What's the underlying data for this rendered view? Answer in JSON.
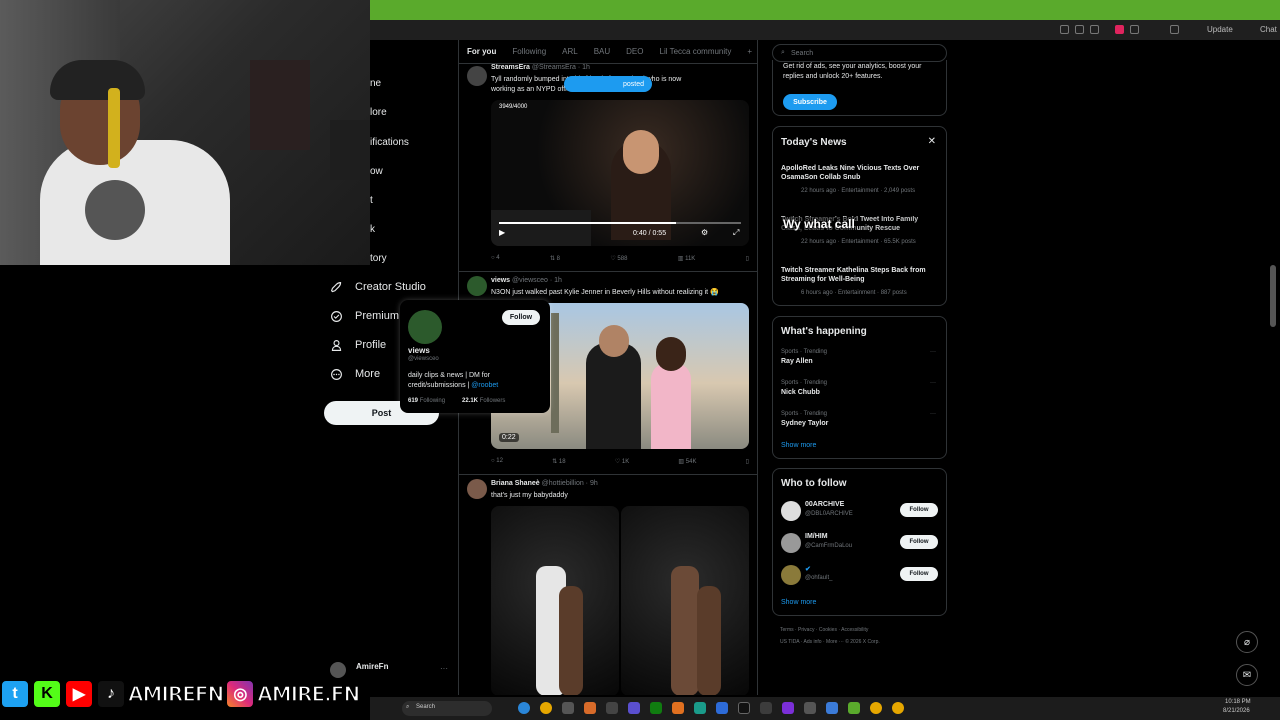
{
  "browser": {
    "update_label": "Update",
    "chat_label": "Chat"
  },
  "nav": {
    "partial_items": [
      "ne",
      "lore",
      "ifications",
      "ow",
      "t",
      "k",
      "tory"
    ],
    "items": [
      {
        "label": "Creator Studio",
        "icon": "rocket-icon"
      },
      {
        "label": "Premium",
        "icon": "premium-icon"
      },
      {
        "label": "Profile",
        "icon": "profile-icon"
      },
      {
        "label": "More",
        "icon": "more-circle-icon"
      }
    ],
    "post_label": "Post",
    "account_name": "AmireFn"
  },
  "feed": {
    "tabs": [
      "For you",
      "Following",
      "ARL",
      "BAU",
      "DEO",
      "Lil Tecca community"
    ],
    "posted_pill": "posted",
    "tweets": [
      {
        "name": "StreamsEra",
        "handle": "@StreamsEra · 1h",
        "text_lines": [
          "Tyll randomly bumped into his friends from school who is now",
          "working as an NYPD officer"
        ],
        "video_time": "0:40 / 0:55",
        "overlay_count": "3949/4000",
        "stats": {
          "replies": "4",
          "reposts": "8",
          "likes": "588",
          "views": "11K"
        }
      },
      {
        "name": "views",
        "handle": "@viewsceo · 1h",
        "text": "N3ON just walked past Kylie Jenner in Beverly Hills without realizing it 😭",
        "duration": "0:22",
        "stats": {
          "replies": "12",
          "reposts": "18",
          "likes": "1K",
          "views": "54K"
        }
      },
      {
        "name": "Briana Shaneè",
        "handle": "@hottiebillion · 9h",
        "text": "that's just my babydaddy"
      }
    ]
  },
  "hovercard": {
    "name": "views",
    "handle": "@viewsceo",
    "follow_label": "Follow",
    "bio_line1": "daily clips & news | DM for",
    "bio_line2": "credit/submissions |",
    "bio_link": "@roobet",
    "following_count": "619",
    "following_label": "Following",
    "followers_count": "22.1K",
    "followers_label": "Followers"
  },
  "right": {
    "search_placeholder": "Search",
    "premium_text_1": "Get rid of ads, see your analytics, boost your",
    "premium_text_2": "replies and unlock 20+ features.",
    "subscribe_label": "Subscribe",
    "news_title": "Today's News",
    "news": [
      {
        "headline_1": "ApolloRed Leaks Nine Vicious Texts Over",
        "headline_2": "OsamaSon Collab Snub",
        "meta": "22 hours ago · Entertainment · 2,049 posts"
      },
      {
        "headline_1": "Twitch Streamer's Bold Tweet Into Family",
        "headline_2": "Clash, Leads to Community Rescue",
        "meta": "22 hours ago · Entertainment · 65.5K posts"
      },
      {
        "headline_1": "Twitch Streamer Kathelina Steps Back from",
        "headline_2": "Streaming for Well-Being",
        "meta": "6 hours ago · Entertainment · 887 posts"
      }
    ],
    "caption_overlay": "what call",
    "happening_title": "What's happening",
    "trends": [
      {
        "category": "Sports · Trending",
        "name": "Ray Allen"
      },
      {
        "category": "Sports · Trending",
        "name": "Nick Chubb"
      },
      {
        "category": "Sports · Trending",
        "name": "Sydney Taylor"
      }
    ],
    "show_more": "Show more",
    "who_title": "Who to follow",
    "follow_suggestions": [
      {
        "name": "00ARCHIVE",
        "handle": "@DBL0ARCHIVE"
      },
      {
        "name": "IM/HIM",
        "handle": "@CamFrmDaLou"
      },
      {
        "name": "",
        "handle": "@ohfault_"
      }
    ],
    "follow_label": "Follow",
    "footer_1": "Terms  ·  Privacy  ·  Cookies  ·  Accessibility",
    "footer_2": "US TIDA  ·  Ads info  ·  More ···  © 2026 X Corp."
  },
  "taskbar": {
    "search_label": "Search",
    "time": "10:18 PM",
    "date": "8/21/2026"
  },
  "overlay": {
    "handle_1": "AMIREFN",
    "handle_2": "AMIRE.FN"
  },
  "colors": {
    "accent": "#1d9bf0",
    "green_bar": "#5aaa2c",
    "background": "#000000"
  }
}
